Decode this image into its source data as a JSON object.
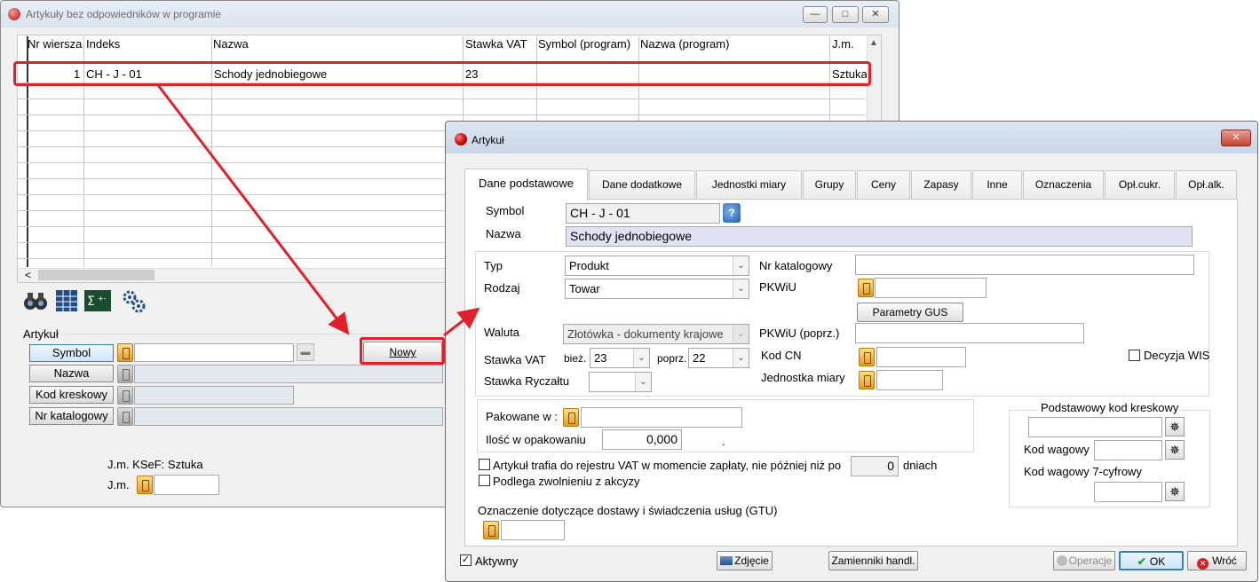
{
  "bg_window": {
    "title": "Artykuły bez odpowiedników w programie",
    "columns": [
      "Nr wiersza",
      "Indeks",
      "Nazwa",
      "Stawka VAT",
      "Symbol (program)",
      "Nazwa (program)",
      "J.m."
    ],
    "row": {
      "nr": "1",
      "indeks": "CH - J - 01",
      "nazwa": "Schody jednobiegowe",
      "vat": "23",
      "jm": "Sztuka"
    },
    "scroll_left": "<",
    "section_label": "Artykuł",
    "search_buttons": [
      "Symbol",
      "Nazwa",
      "Kod kreskowy",
      "Nr katalogowy"
    ],
    "new_button": "Nowy",
    "jm_ksef": "J.m. KSeF: Sztuka",
    "jm_label": "J.m."
  },
  "dialog": {
    "title": "Artykuł",
    "tabs": [
      "Dane podstawowe",
      "Dane dodatkowe",
      "Jednostki miary",
      "Grupy",
      "Ceny",
      "Zapasy",
      "Inne",
      "Oznaczenia",
      "Opł.cukr.",
      "Opł.alk."
    ],
    "symbol_label": "Symbol",
    "symbol_value": "CH - J - 01",
    "nazwa_label": "Nazwa",
    "nazwa_value": "Schody jednobiegowe",
    "typ_label": "Typ",
    "typ_value": "Produkt",
    "rodzaj_label": "Rodzaj",
    "rodzaj_value": "Towar",
    "nr_katalogowy_label": "Nr katalogowy",
    "pkwiu_label": "PKWiU",
    "parametry_gus": "Parametry GUS",
    "waluta_label": "Waluta",
    "waluta_value": "Złotówka - dokumenty krajowe",
    "pkwiu_poprz_label": "PKWiU (poprz.)",
    "stawka_vat_label": "Stawka VAT",
    "biez_label": "bież.",
    "biez_value": "23",
    "poprz_label": "poprz.",
    "poprz_value": "22",
    "kod_cn_label": "Kod CN",
    "decyzja_wis": "Decyzja WIS",
    "stawka_ryczaltu_label": "Stawka Ryczałtu",
    "jednostka_miary_label": "Jednostka miary",
    "pakowane_label": "Pakowane w :",
    "ilosc_label": "Ilość w opakowaniu",
    "ilosc_value": "0,000",
    "dot": ".",
    "kod_kreskowy_title": "Podstawowy kod kreskowy",
    "kod_wagowy": "Kod wagowy",
    "kod_wagowy7": "Kod wagowy 7-cyfrowy",
    "vat_register_text": "Artykuł trafia do rejestru VAT w momencie zapłaty, nie później niż po",
    "vat_days_value": "0",
    "dniach": "dniach",
    "akcyza": "Podlega zwolnieniu z akcyzy",
    "gtu_label": "Oznaczenie dotyczące dostawy i świadczenia usług (GTU)",
    "aktywny": "Aktywny",
    "zdjecie": "Zdjęcie",
    "zamienniki": "Zamienniki handl.",
    "operacje": "Operacje",
    "ok": "OK",
    "wroc": "Wróć",
    "checkmark": "✓"
  },
  "colors": {
    "highlight": "#e0202a",
    "dialog_bg": "#f0f0f0",
    "selected_blue": "#3c7fb1"
  }
}
